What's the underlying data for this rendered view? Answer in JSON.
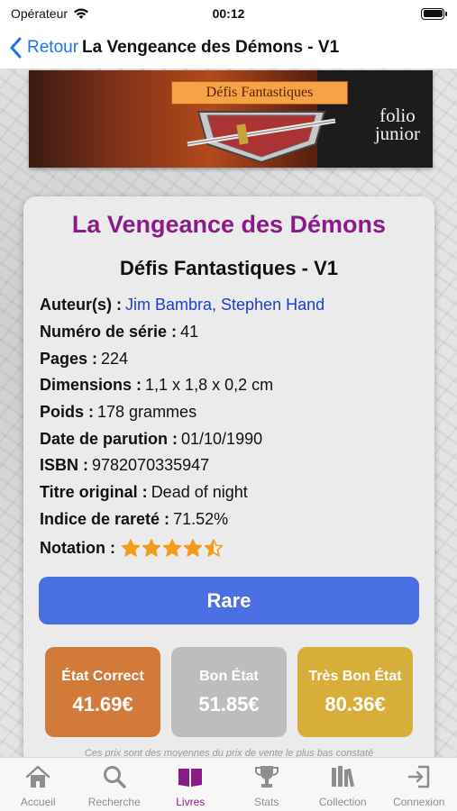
{
  "status_bar": {
    "carrier": "Opérateur",
    "time": "00:12"
  },
  "nav": {
    "back_label": "Retour",
    "title": "La Vengeance des Démons - V1"
  },
  "cover": {
    "series_banner": "Défis Fantastiques",
    "logo_line1": "folio",
    "logo_line2": "junior"
  },
  "book": {
    "title": "La Vengeance des Démons",
    "subtitle": "Défis Fantastiques - V1",
    "details": [
      {
        "label": "Auteur(s) :",
        "value": "Jim Bambra, Stephen Hand",
        "link": true
      },
      {
        "label": "Numéro de série :",
        "value": "41"
      },
      {
        "label": "Pages :",
        "value": "224"
      },
      {
        "label": "Dimensions :",
        "value": "1,1 x 1,8 x 0,2 cm"
      },
      {
        "label": "Poids :",
        "value": "178 grammes"
      },
      {
        "label": "Date de parution :",
        "value": "01/10/1990"
      },
      {
        "label": "ISBN :",
        "value": "9782070335947"
      },
      {
        "label": "Titre original :",
        "value": "Dead of night"
      },
      {
        "label": "Indice de rareté :",
        "value": "71.52%"
      }
    ],
    "rating_label": "Notation :",
    "rating_value": 4.5,
    "rating_max": 5,
    "star_color": "#f39c1a",
    "rarity_button": "Rare",
    "prices": [
      {
        "label": "État Correct",
        "value": "41.69€",
        "color": "#d27a3a"
      },
      {
        "label": "Bon État",
        "value": "51.85€",
        "color": "#bdbdbd"
      },
      {
        "label": "Très Bon État",
        "value": "80.36€",
        "color": "#d8ae3a"
      }
    ],
    "footnote": "Ces prix sont des moyennes du prix de vente le plus bas constaté"
  },
  "tabs": [
    {
      "label": "Accueil",
      "icon": "home-icon",
      "active": false
    },
    {
      "label": "Recherche",
      "icon": "search-icon",
      "active": false
    },
    {
      "label": "Livres",
      "icon": "book-icon",
      "active": true
    },
    {
      "label": "Stats",
      "icon": "trophy-icon",
      "active": false
    },
    {
      "label": "Collection",
      "icon": "library-icon",
      "active": false
    },
    {
      "label": "Connexion",
      "icon": "login-icon",
      "active": false
    }
  ],
  "colors": {
    "accent": "#8a1b8a",
    "link": "#1a3fd8",
    "button": "#4a6fe3",
    "back": "#1a73e8"
  }
}
